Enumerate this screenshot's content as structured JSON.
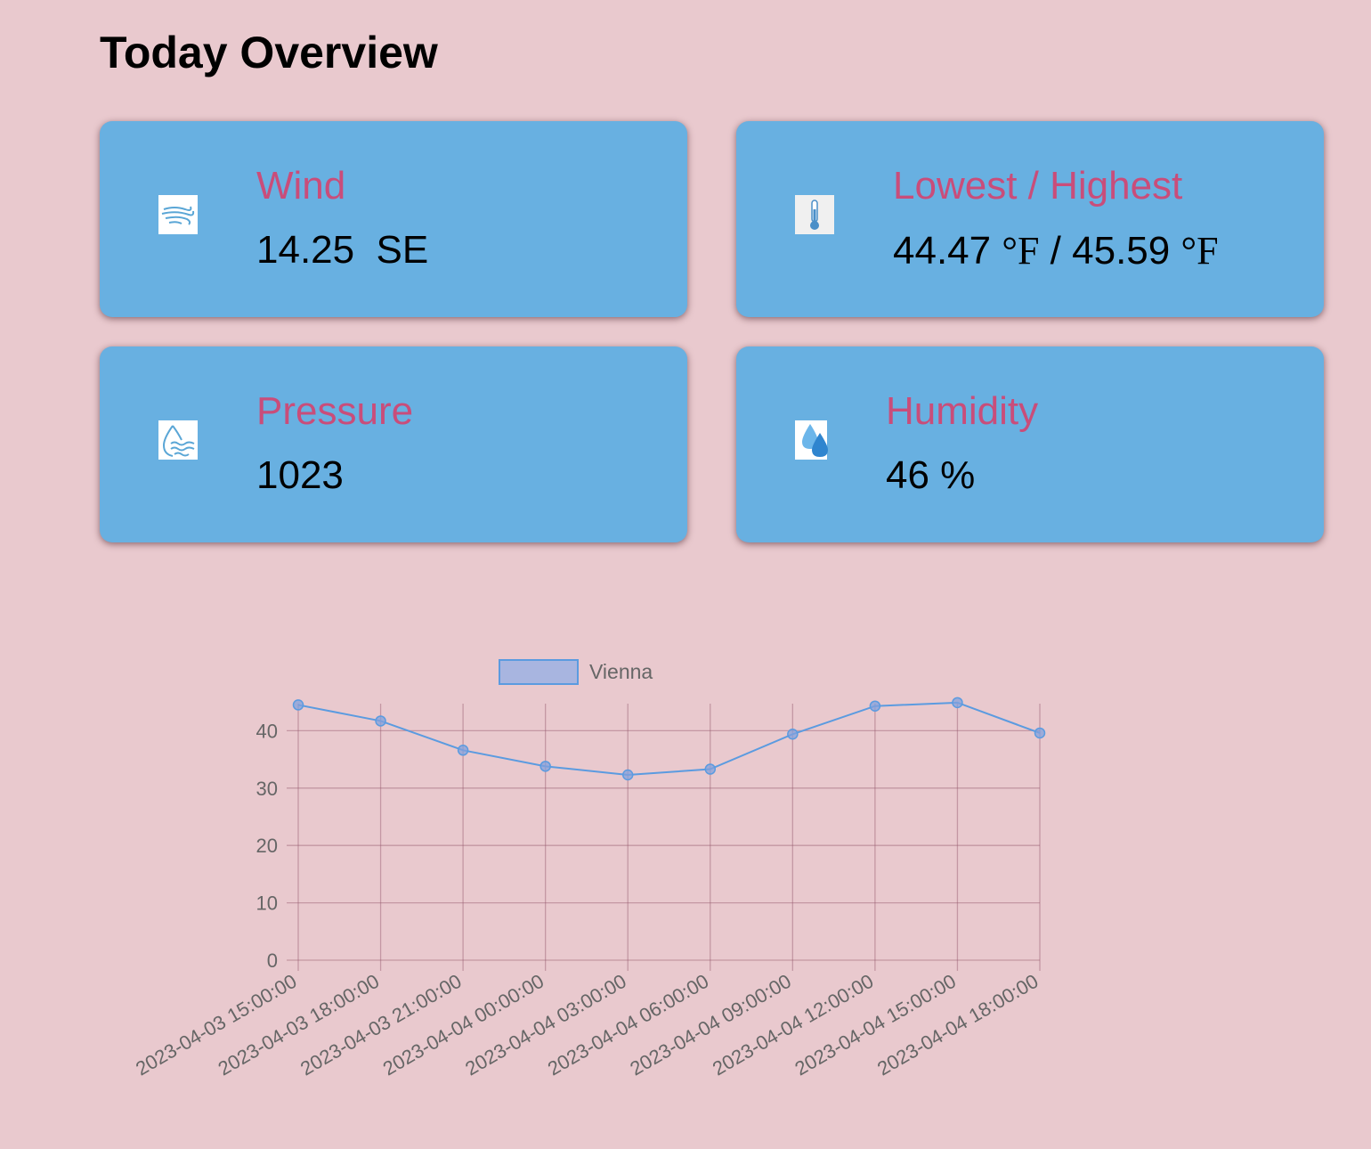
{
  "page": {
    "title": "Today Overview"
  },
  "cards": {
    "wind": {
      "label": "Wind",
      "value": "14.25  SE",
      "icon": "wind-icon"
    },
    "temperature": {
      "label": "Lowest / Highest",
      "low": "44.47",
      "high": "45.59",
      "unit": "°F",
      "separator": "/",
      "icon": "thermometer-icon"
    },
    "pressure": {
      "label": "Pressure",
      "value": "1023",
      "icon": "pressure-drop-icon"
    },
    "humidity": {
      "label": "Humidity",
      "value": "46 %",
      "icon": "humidity-drops-icon"
    }
  },
  "colors": {
    "background": "#e9c9ce",
    "card": "#68b0e1",
    "label": "#c94d7a",
    "line": "#5b9be0",
    "legend_fill": "#a8b5e0"
  },
  "chart_data": {
    "type": "line",
    "title": "",
    "xlabel": "",
    "ylabel": "",
    "x": [
      "2023-04-03 15:00:00",
      "2023-04-03 18:00:00",
      "2023-04-03 21:00:00",
      "2023-04-04 00:00:00",
      "2023-04-04 03:00:00",
      "2023-04-04 06:00:00",
      "2023-04-04 09:00:00",
      "2023-04-04 12:00:00",
      "2023-04-04 15:00:00",
      "2023-04-04 18:00:00"
    ],
    "series": [
      {
        "name": "Vienna",
        "values": [
          44.5,
          41.7,
          36.6,
          33.8,
          32.3,
          33.3,
          39.4,
          44.3,
          44.9,
          39.6
        ]
      }
    ],
    "yticks": [
      "0",
      "10",
      "20",
      "30",
      "40"
    ],
    "ylim": [
      0,
      45
    ],
    "grid": true,
    "legend": "top"
  }
}
